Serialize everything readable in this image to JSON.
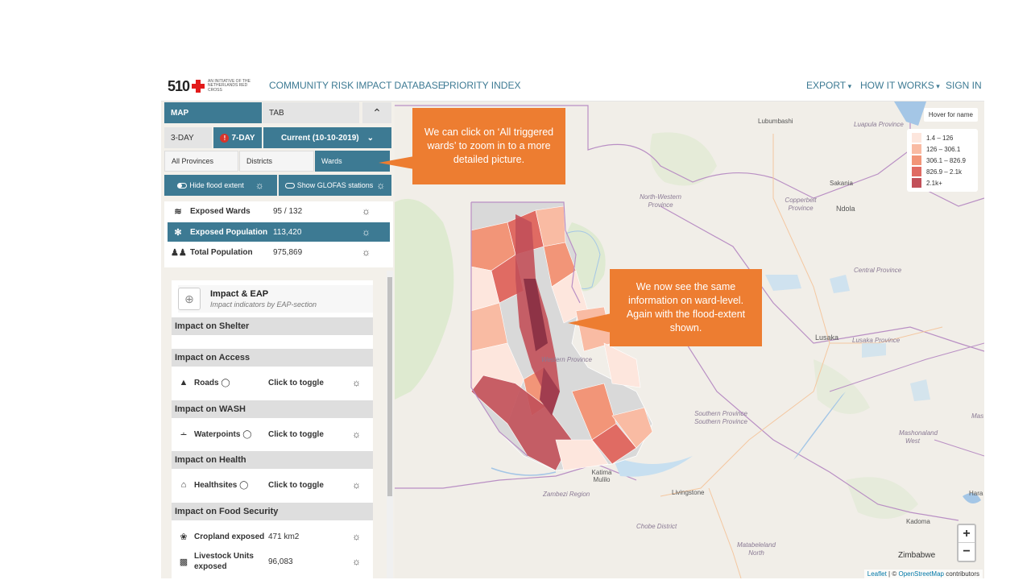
{
  "logo": {
    "number": "510",
    "tagline": "AN INITIATIVE OF THE NETHERLANDS RED CROSS"
  },
  "nav": {
    "left": [
      "COMMUNITY RISK",
      "IMPACT DATABASE",
      "PRIORITY INDEX"
    ],
    "right": [
      "EXPORT",
      "HOW IT WORKS",
      "SIGN IN"
    ]
  },
  "sidebar": {
    "view_tabs": [
      "MAP",
      "TAB"
    ],
    "lead_time": [
      "3-DAY",
      "7-DAY"
    ],
    "current": "Current (10-10-2019)",
    "admin_levels": [
      "All Provinces",
      "Districts",
      "Wards"
    ],
    "toggles": {
      "flood": "Hide flood extent",
      "glofas": "Show GLOFAS stations"
    },
    "stats": [
      {
        "label": "Exposed Wards",
        "value": "95 / 132",
        "icon": "flood-icon"
      },
      {
        "label": "Exposed Population",
        "value": "113,420",
        "icon": "people-icon"
      },
      {
        "label": "Total Population",
        "value": "975,869",
        "icon": "family-icon"
      }
    ],
    "panel": {
      "title": "Impact & EAP",
      "subtitle": "Impact indicators by EAP-section",
      "sections": [
        {
          "title": "Impact on Shelter"
        },
        {
          "title": "Impact on Access",
          "row": {
            "name": "Roads",
            "value": "Click to toggle"
          }
        },
        {
          "title": "Impact on WASH",
          "row": {
            "name": "Waterpoints",
            "value": "Click to toggle"
          }
        },
        {
          "title": "Impact on Health",
          "row": {
            "name": "Healthsites",
            "value": "Click to toggle"
          }
        },
        {
          "title": "Impact on Food Security"
        }
      ],
      "food_rows": [
        {
          "name": "Cropland exposed",
          "value": "471 km2"
        },
        {
          "name": "Livestock Units exposed",
          "value": "96,083"
        }
      ]
    }
  },
  "map": {
    "hover": "Hover for name",
    "legend": [
      {
        "label": "1.4 – 126",
        "color": "#fde6dd"
      },
      {
        "label": "126 – 306.1",
        "color": "#f9bba3"
      },
      {
        "label": "306.1 – 826.9",
        "color": "#f29578"
      },
      {
        "label": "826.9 – 2.1k",
        "color": "#e06b63"
      },
      {
        "label": "2.1k+",
        "color": "#c25059"
      }
    ],
    "places": [
      "Lubumbashi",
      "Sakania",
      "Ndola",
      "Lusaka",
      "Livingstone",
      "Katima Mulilo",
      "Kadoma",
      "Zimbabwe",
      "Hara"
    ],
    "provinces": [
      "Luapula Province",
      "North-Western Province",
      "Copperbelt Province",
      "Central Province",
      "Lusaka Province",
      "Western Province",
      "Southern Province Southern Province",
      "Zambezi Region",
      "Chobe District",
      "Mashonaland West",
      "Matabeleland North",
      "Mas"
    ],
    "zoom_in": "+",
    "zoom_out": "−",
    "attrib_leaflet": "Leaflet",
    "attrib_sep": "| ©",
    "attrib_osm": "OpenStreetMap",
    "attrib_rest": "contributors"
  },
  "callouts": [
    "We can click on ‘All triggered wards’ to zoom in to a more detailed picture.",
    "We now see the same information on ward-level. Again with the flood-extent shown."
  ],
  "colors": {
    "teal": "#3d7a93",
    "orange": "#ed7d31",
    "sidebar_bg": "#f3f0ea"
  }
}
